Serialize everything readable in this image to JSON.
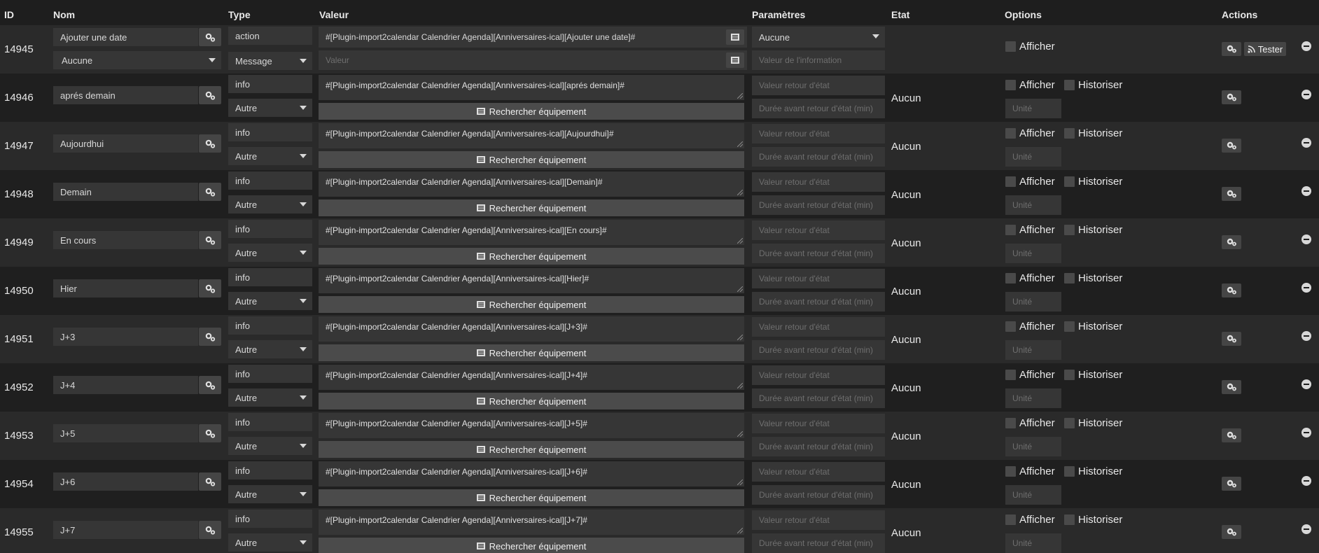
{
  "columns": {
    "id": "ID",
    "nom": "Nom",
    "type": "Type",
    "valeur": "Valeur",
    "parametres": "Paramètres",
    "etat": "Etat",
    "options": "Options",
    "actions": "Actions"
  },
  "first_row": {
    "id": "14945",
    "name": "Ajouter une date",
    "name_select": "Aucune",
    "type": "action",
    "subtype": "Message",
    "value": "#[Plugin-import2calendar Calendrier Agenda][Anniversaires-ical][Ajouter une date]#",
    "value2_placeholder": "Valeur",
    "param_select": "Aucune",
    "param_placeholder": "Valeur de l'information",
    "afficher": "Afficher",
    "tester": "Tester"
  },
  "info_row_labels": {
    "type": "info",
    "subtype": "Autre",
    "search": "Rechercher équipement",
    "param1_placeholder": "Valeur retour d'état",
    "param2_placeholder": "Durée avant retour d'état (min)",
    "etat": "Aucun",
    "afficher": "Afficher",
    "historiser": "Historiser",
    "unit_placeholder": "Unité"
  },
  "rows": [
    {
      "id": "14946",
      "name": "aprés demain",
      "value": "#[Plugin-import2calendar Calendrier Agenda][Anniversaires-ical][aprés demain]#"
    },
    {
      "id": "14947",
      "name": "Aujourdhui",
      "value": "#[Plugin-import2calendar Calendrier Agenda][Anniversaires-ical][Aujourdhui]#"
    },
    {
      "id": "14948",
      "name": "Demain",
      "value": "#[Plugin-import2calendar Calendrier Agenda][Anniversaires-ical][Demain]#"
    },
    {
      "id": "14949",
      "name": "En cours",
      "value": "#[Plugin-import2calendar Calendrier Agenda][Anniversaires-ical][En cours]#"
    },
    {
      "id": "14950",
      "name": "Hier",
      "value": "#[Plugin-import2calendar Calendrier Agenda][Anniversaires-ical][Hier]#"
    },
    {
      "id": "14951",
      "name": "J+3",
      "value": "#[Plugin-import2calendar Calendrier Agenda][Anniversaires-ical][J+3]#"
    },
    {
      "id": "14952",
      "name": "J+4",
      "value": "#[Plugin-import2calendar Calendrier Agenda][Anniversaires-ical][J+4]#"
    },
    {
      "id": "14953",
      "name": "J+5",
      "value": "#[Plugin-import2calendar Calendrier Agenda][Anniversaires-ical][J+5]#"
    },
    {
      "id": "14954",
      "name": "J+6",
      "value": "#[Plugin-import2calendar Calendrier Agenda][Anniversaires-ical][J+6]#"
    },
    {
      "id": "14955",
      "name": "J+7",
      "value": "#[Plugin-import2calendar Calendrier Agenda][Anniversaires-ical][J+7]#"
    }
  ]
}
